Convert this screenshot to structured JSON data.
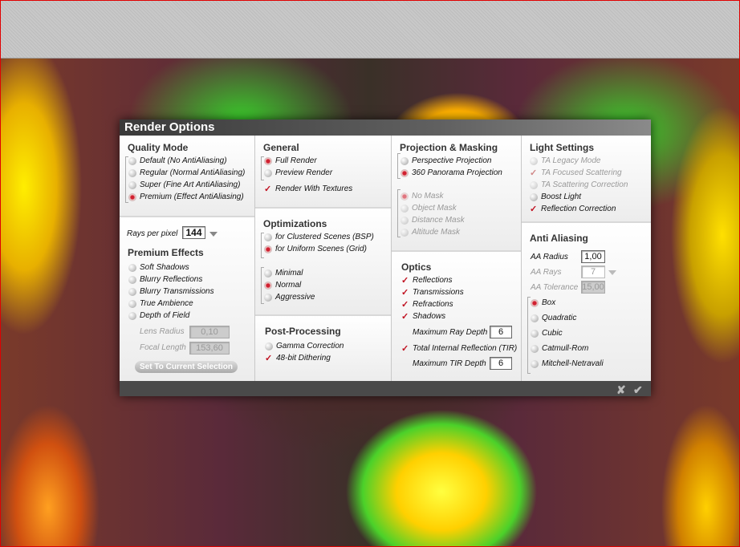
{
  "title": "Render Options",
  "quality": {
    "heading": "Quality Mode",
    "items": [
      "Default (No AntiAliasing)",
      "Regular (Normal AntiAliasing)",
      "Super (Fine Art AntiAliasing)",
      "Premium (Effect AntiAliasing)"
    ],
    "selected": 3
  },
  "rays": {
    "label": "Rays per pixel",
    "value": "144"
  },
  "premium": {
    "heading": "Premium Effects",
    "items": [
      "Soft Shadows",
      "Blurry Reflections",
      "Blurry Transmissions",
      "True Ambience",
      "Depth of Field"
    ],
    "lens_label": "Lens Radius",
    "lens_value": "0,10",
    "focal_label": "Focal Length",
    "focal_value": "153,60",
    "button": "Set To Current Selection"
  },
  "general": {
    "heading": "General",
    "items": [
      "Full Render",
      "Preview Render"
    ],
    "selected": 0,
    "textures": "Render With Textures",
    "textures_checked": true
  },
  "optimizations": {
    "heading": "Optimizations",
    "scene_items": [
      "for Clustered Scenes (BSP)",
      "for Uniform Scenes (Grid)"
    ],
    "scene_selected": 1,
    "level_items": [
      "Minimal",
      "Normal",
      "Aggressive"
    ],
    "level_selected": 1
  },
  "post": {
    "heading": "Post-Processing",
    "gamma": "Gamma Correction",
    "gamma_checked": false,
    "dither": "48-bit Dithering",
    "dither_checked": true
  },
  "projection": {
    "heading": "Projection & Masking",
    "items": [
      "Perspective Projection",
      "360  Panorama Projection"
    ],
    "selected": 1,
    "mask_items": [
      "No Mask",
      "Object Mask",
      "Distance Mask",
      "Altitude Mask"
    ],
    "mask_selected": 0
  },
  "optics": {
    "heading": "Optics",
    "items": [
      "Reflections",
      "Transmissions",
      "Refractions",
      "Shadows"
    ],
    "max_ray_label": "Maximum Ray Depth",
    "max_ray_value": "6",
    "tir": "Total Internal Reflection (TIR)",
    "max_tir_label": "Maximum TIR Depth",
    "max_tir_value": "6"
  },
  "light": {
    "heading": "Light Settings",
    "items": [
      "TA Legacy Mode",
      "TA Focused Scattering",
      "TA Scattering Correction",
      "Boost Light",
      "Reflection Correction"
    ]
  },
  "aa": {
    "heading": "Anti Aliasing",
    "radius_label": "AA Radius",
    "radius_value": "1,00",
    "rays_label": "AA Rays",
    "rays_value": "7",
    "tol_label": "AA Tolerance",
    "tol_value": "15,00",
    "filters": [
      "Box",
      "Quadratic",
      "Cubic",
      "Catmull-Rom",
      "Mitchell-Netravali"
    ],
    "filter_selected": 0
  },
  "footer": {
    "cancel": "✘",
    "ok": "✔"
  },
  "colors": {
    "accent": "#c01020",
    "titlebar": "#3a3a3a"
  }
}
